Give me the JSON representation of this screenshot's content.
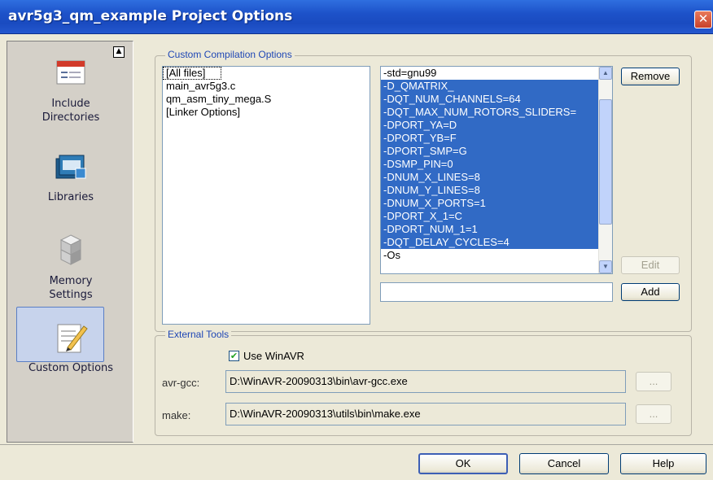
{
  "window": {
    "title": "avr5g3_qm_example Project Options",
    "close_icon": "close-icon"
  },
  "sidebar": {
    "items": [
      {
        "label": "Include\nDirectories",
        "icon": "include-directories-icon"
      },
      {
        "label": "Libraries",
        "icon": "libraries-icon"
      },
      {
        "label": "Memory\nSettings",
        "icon": "memory-settings-icon"
      },
      {
        "label": "Custom Options",
        "icon": "custom-options-icon",
        "selected": true
      }
    ]
  },
  "custom_compilation": {
    "legend": "Custom Compilation Options",
    "files": [
      "[All files]",
      "main_avr5g3.c",
      "qm_asm_tiny_mega.S",
      "[Linker Options]"
    ],
    "options": [
      {
        "text": "-std=gnu99",
        "selected": false
      },
      {
        "text": "-D_QMATRIX_",
        "selected": true
      },
      {
        "text": "-DQT_NUM_CHANNELS=64",
        "selected": true
      },
      {
        "text": "-DQT_MAX_NUM_ROTORS_SLIDERS=",
        "selected": true
      },
      {
        "text": "-DPORT_YA=D",
        "selected": true
      },
      {
        "text": "-DPORT_YB=F",
        "selected": true
      },
      {
        "text": "-DPORT_SMP=G",
        "selected": true
      },
      {
        "text": "-DSMP_PIN=0",
        "selected": true
      },
      {
        "text": "-DNUM_X_LINES=8",
        "selected": true
      },
      {
        "text": "-DNUM_Y_LINES=8",
        "selected": true
      },
      {
        "text": "-DNUM_X_PORTS=1",
        "selected": true
      },
      {
        "text": "-DPORT_X_1=C",
        "selected": true
      },
      {
        "text": "-DPORT_NUM_1=1",
        "selected": true
      },
      {
        "text": "-DQT_DELAY_CYCLES=4",
        "selected": true
      },
      {
        "text": "-Os",
        "selected": false
      }
    ],
    "remove_label": "Remove",
    "edit_label": "Edit",
    "add_label": "Add",
    "new_option_value": ""
  },
  "external_tools": {
    "legend": "External Tools",
    "use_winavr_label": "Use WinAVR",
    "use_winavr_checked": true,
    "avr_gcc_label": "avr-gcc:",
    "avr_gcc_path": "D:\\WinAVR-20090313\\bin\\avr-gcc.exe",
    "make_label": "make:",
    "make_path": "D:\\WinAVR-20090313\\utils\\bin\\make.exe",
    "browse_label": "..."
  },
  "footer": {
    "ok_label": "OK",
    "cancel_label": "Cancel",
    "help_label": "Help"
  }
}
